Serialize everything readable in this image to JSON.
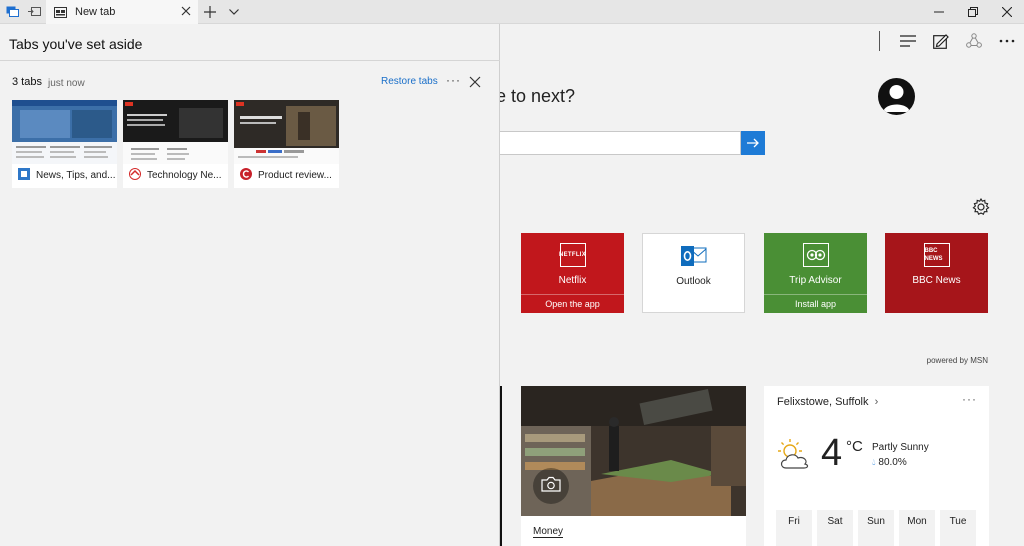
{
  "tabbar": {
    "active_tab_title": "New tab"
  },
  "panel": {
    "title": "Tabs you've set aside",
    "group": {
      "count_label": "3 tabs",
      "time_label": "just now",
      "restore_label": "Restore tabs",
      "more_label": "···"
    },
    "tabs": [
      {
        "title": "News, Tips, and...",
        "favicon": "news-favicon"
      },
      {
        "title": "Technology Ne...",
        "favicon": "technology-favicon"
      },
      {
        "title": "Product review...",
        "favicon": "product-review-favicon"
      }
    ]
  },
  "page": {
    "question": "e to next?",
    "tiles": [
      {
        "name": "Netflix",
        "sub": "Open the app",
        "color": "#c1171c",
        "logo_text": "NETFLIX"
      },
      {
        "name": "Outlook",
        "sub": "",
        "color": "#ffffff",
        "logo_text": ""
      },
      {
        "name": "Trip Advisor",
        "sub": "Install app",
        "color": "#4a8f35",
        "logo_text": ""
      },
      {
        "name": "BBC News",
        "sub": "",
        "color": "#a6151a",
        "logo_text": "BBC NEWS"
      }
    ],
    "powered_by": "powered by MSN",
    "news": {
      "label": "Money"
    },
    "weather": {
      "location": "Felixstowe, Suffolk",
      "location_chevron": "›",
      "more": "···",
      "temperature": "4",
      "unit": "°C",
      "condition": "Partly Sunny",
      "humidity": "80.0%",
      "days": [
        "Fri",
        "Sat",
        "Sun",
        "Mon",
        "Tue"
      ]
    }
  },
  "colors": {
    "accent": "#1e7bd6",
    "link": "#1a6fc9"
  }
}
